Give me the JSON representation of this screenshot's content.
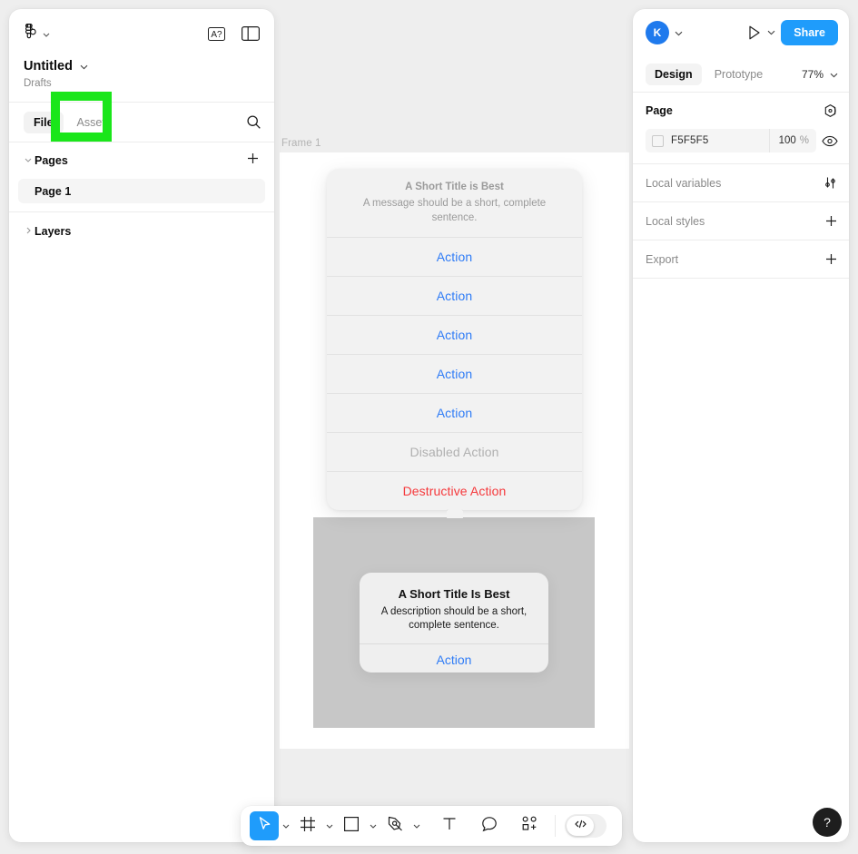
{
  "left_panel": {
    "logo_icon": "figma-logo-icon",
    "logo_caret_icon": "chevron-down-icon",
    "spellcheck_icon": "a-question-icon",
    "panel_toggle_icon": "sidebar-toggle-icon",
    "file_title": "Untitled",
    "file_title_caret_icon": "chevron-down-icon",
    "file_subtitle": "Drafts",
    "tabs": [
      {
        "label": "File",
        "active": true
      },
      {
        "label": "Assets",
        "active": false
      }
    ],
    "search_icon": "search-icon",
    "pages": {
      "section_label": "Pages",
      "caret_icon": "chevron-down-icon",
      "add_icon": "plus-icon",
      "items": [
        {
          "label": "Page 1",
          "selected": true
        }
      ]
    },
    "layers": {
      "section_label": "Layers",
      "caret_icon": "chevron-right-icon"
    }
  },
  "right_panel": {
    "avatar_initial": "K",
    "avatar_caret_icon": "chevron-down-icon",
    "present_icon": "play-icon",
    "present_caret_icon": "chevron-down-icon",
    "share_label": "Share",
    "tabs": [
      {
        "label": "Design",
        "active": true
      },
      {
        "label": "Prototype",
        "active": false
      }
    ],
    "zoom_label": "77%",
    "zoom_caret_icon": "chevron-down-icon",
    "page_section": {
      "title": "Page",
      "styles_icon": "style-hexagon-icon",
      "fill": {
        "swatch_icon": "color-swatch",
        "hex": "F5F5F5",
        "opacity": "100",
        "opacity_unit": "%",
        "visibility_icon": "eye-icon"
      }
    },
    "local_variables": {
      "title": "Local variables",
      "icon": "sliders-icon"
    },
    "local_styles": {
      "title": "Local styles",
      "icon": "plus-icon"
    },
    "export": {
      "title": "Export",
      "icon": "plus-icon"
    }
  },
  "canvas": {
    "frame_label": "Frame 1",
    "action_sheet": {
      "title": "A Short Title is Best",
      "message": "A message should be a short, complete sentence.",
      "rows": [
        {
          "label": "Action",
          "style": "normal"
        },
        {
          "label": "Action",
          "style": "normal"
        },
        {
          "label": "Action",
          "style": "normal"
        },
        {
          "label": "Action",
          "style": "normal"
        },
        {
          "label": "Action",
          "style": "normal"
        },
        {
          "label": "Disabled Action",
          "style": "disabled"
        },
        {
          "label": "Destructive Action",
          "style": "destructive"
        }
      ]
    },
    "alert": {
      "title": "A Short Title Is Best",
      "description": "A description should be a short, complete sentence.",
      "action_label": "Action"
    }
  },
  "toolbar": {
    "tools": [
      {
        "name": "move-tool",
        "icon": "cursor-icon",
        "active": true,
        "has_caret": true
      },
      {
        "name": "frame-tool",
        "icon": "frame-icon",
        "active": false,
        "has_caret": true
      },
      {
        "name": "shape-tool",
        "icon": "square-icon",
        "active": false,
        "has_caret": true
      },
      {
        "name": "pen-tool",
        "icon": "pen-icon",
        "active": false,
        "has_caret": true
      },
      {
        "name": "text-tool",
        "icon": "text-icon",
        "active": false,
        "has_caret": false
      },
      {
        "name": "comment-tool",
        "icon": "comment-icon",
        "active": false,
        "has_caret": false
      },
      {
        "name": "actions-tool",
        "icon": "plugins-icon",
        "active": false,
        "has_caret": false
      }
    ],
    "devmode_icon": "code-icon"
  },
  "help": {
    "icon": "question-mark-icon",
    "label": "?"
  },
  "highlight": {
    "target": "assets-tab",
    "color": "#1AE61A"
  },
  "colors": {
    "accent_blue": "#1F9CFB",
    "action_blue": "#2F7CF6",
    "destructive_red": "#F5383B",
    "canvas_bg": "#EEEEEE",
    "page_fill": "#F5F5F5"
  }
}
